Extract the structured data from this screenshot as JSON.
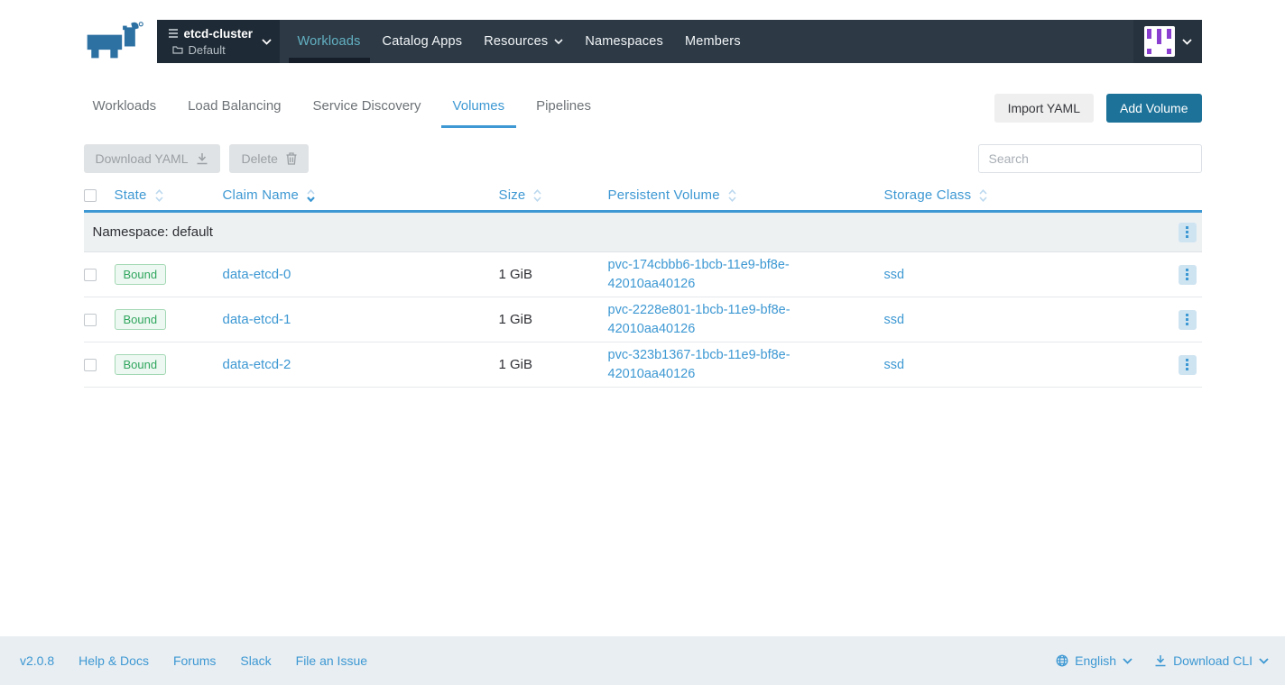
{
  "colors": {
    "accent_blue": "#3d98d3",
    "navbar_dark": "#2d3a46",
    "nav_active_teal": "#63b1c2",
    "primary_button_teal": "#1c7299",
    "bound_green": "#2fa65e",
    "avatar_purple": "#8a3fd1",
    "group_row_bg": "#edf1f2",
    "footer_bg": "#e9eef2"
  },
  "icons": {
    "logo": "rancher-cow",
    "cluster": "stacked-list",
    "project": "folder",
    "dropdown": "chevron-down",
    "download": "download-arrow",
    "delete": "trash",
    "sort": "chevron-up-down",
    "row_menu": "vertical-dots",
    "language": "globe"
  },
  "topnav": {
    "cluster": {
      "name": "etcd-cluster",
      "project": "Default"
    },
    "items": [
      {
        "label": "Workloads",
        "active": true
      },
      {
        "label": "Catalog Apps",
        "active": false
      },
      {
        "label": "Resources",
        "active": false,
        "dropdown": true
      },
      {
        "label": "Namespaces",
        "active": false
      },
      {
        "label": "Members",
        "active": false
      }
    ]
  },
  "tabs": [
    {
      "label": "Workloads",
      "active": false
    },
    {
      "label": "Load Balancing",
      "active": false
    },
    {
      "label": "Service Discovery",
      "active": false
    },
    {
      "label": "Volumes",
      "active": true
    },
    {
      "label": "Pipelines",
      "active": false
    }
  ],
  "actions": {
    "import_yaml": "Import YAML",
    "add_volume": "Add Volume",
    "download_yaml": "Download YAML",
    "delete": "Delete",
    "search_placeholder": "Search"
  },
  "table": {
    "columns": {
      "state": "State",
      "claim_name": "Claim Name",
      "size": "Size",
      "persistent_volume": "Persistent Volume",
      "storage_class": "Storage Class"
    },
    "sorted_by": "Claim Name",
    "group_label": "Namespace: default",
    "rows": [
      {
        "state": "Bound",
        "claim_name": "data-etcd-0",
        "size": "1 GiB",
        "persistent_volume": "pvc-174cbbb6-1bcb-11e9-bf8e-42010aa40126",
        "storage_class": "ssd"
      },
      {
        "state": "Bound",
        "claim_name": "data-etcd-1",
        "size": "1 GiB",
        "persistent_volume": "pvc-2228e801-1bcb-11e9-bf8e-42010aa40126",
        "storage_class": "ssd"
      },
      {
        "state": "Bound",
        "claim_name": "data-etcd-2",
        "size": "1 GiB",
        "persistent_volume": "pvc-323b1367-1bcb-11e9-bf8e-42010aa40126",
        "storage_class": "ssd"
      }
    ]
  },
  "footer": {
    "version": "v2.0.8",
    "links": [
      {
        "label": "Help & Docs"
      },
      {
        "label": "Forums"
      },
      {
        "label": "Slack"
      },
      {
        "label": "File an Issue"
      }
    ],
    "language": "English",
    "download_cli": "Download CLI"
  }
}
